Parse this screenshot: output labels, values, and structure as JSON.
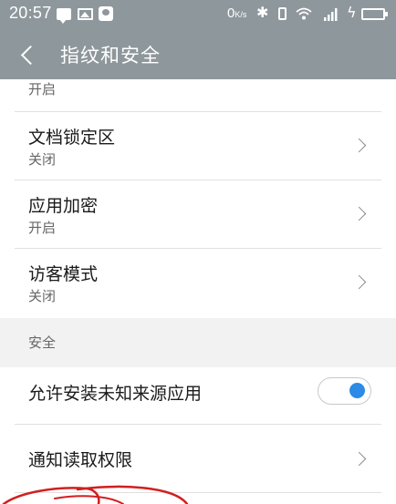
{
  "status_bar": {
    "time": "20:57",
    "net_speed": "0",
    "net_speed_unit": "K/s",
    "icons": [
      "message-icon",
      "image-icon",
      "notification-bag-icon",
      "bluetooth-icon",
      "vibrate-icon",
      "wifi-icon",
      "signal-4g-icon",
      "charging-icon",
      "battery-icon"
    ],
    "bluetooth_glyph": "✱",
    "charge_glyph": "ϟ"
  },
  "title_bar": {
    "back_icon": "chevron-left-icon",
    "title": "指纹和安全"
  },
  "rows": [
    {
      "id": "partial-top",
      "label": "",
      "sub": "开启"
    },
    {
      "id": "doc-lock",
      "label": "文档锁定区",
      "sub": "关闭"
    },
    {
      "id": "app-encrypt",
      "label": "应用加密",
      "sub": "开启"
    },
    {
      "id": "guest-mode",
      "label": "访客模式",
      "sub": "关闭"
    }
  ],
  "section": {
    "label": "安全"
  },
  "security_rows": [
    {
      "id": "unknown-sources",
      "label": "允许安装未知来源应用",
      "toggle_on": true
    },
    {
      "id": "notification-access",
      "label": "通知读取权限"
    }
  ],
  "colors": {
    "header_bg": "#8e979c",
    "section_bg": "#f2f2f2",
    "toggle_accent": "#2b8be6",
    "scribble": "#d21f1f"
  }
}
